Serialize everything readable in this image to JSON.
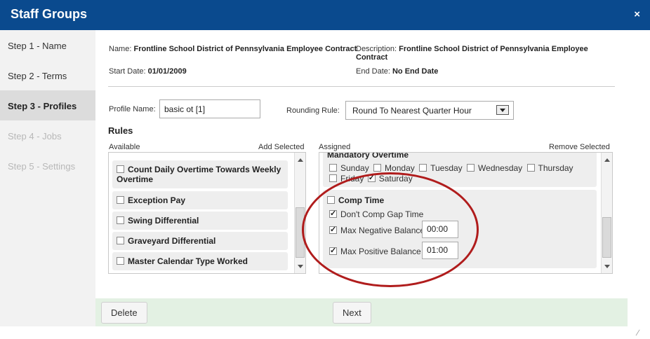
{
  "window": {
    "title": "Staff Groups",
    "close_glyph": "×"
  },
  "steps": [
    {
      "label": "Step 1 - Name"
    },
    {
      "label": "Step 2 - Terms"
    },
    {
      "label": "Step 3 - Profiles"
    },
    {
      "label": "Step 4 - Jobs"
    },
    {
      "label": "Step 5 - Settings"
    }
  ],
  "info": {
    "name_label": "Name:",
    "name_value": "Frontline School District of Pennsylvania Employee Contract",
    "description_label": "Description:",
    "description_value_line1": "Frontline School District of Pennsylvania Employee",
    "description_value_line2": "Contract",
    "start_label": "Start Date:",
    "start_value": "01/01/2009",
    "end_label": "End Date:",
    "end_value": "No End Date"
  },
  "profile": {
    "name_label": "Profile Name:",
    "name_value": "basic ot [1]",
    "rounding_label": "Rounding Rule:",
    "rounding_value": "Round To Nearest Quarter Hour"
  },
  "rules": {
    "heading": "Rules",
    "available_label": "Available",
    "add_selected": "Add Selected",
    "assigned_label": "Assigned",
    "remove_selected": "Remove Selected",
    "available_items": [
      {
        "label_line1": "Count Daily Overtime Towards Weekly",
        "label_line2": "Overtime"
      },
      {
        "label": "Exception Pay"
      },
      {
        "label": "Swing Differential"
      },
      {
        "label": "Graveyard Differential"
      },
      {
        "label": "Master Calendar Type Worked"
      }
    ],
    "assigned": {
      "cut_item": "Mandatory Overtime",
      "days": [
        "Sunday",
        "Monday",
        "Tuesday",
        "Wednesday",
        "Thursday",
        "Friday",
        "Saturday"
      ],
      "comp_time_label": "Comp Time",
      "dont_comp_gap": "Don't Comp Gap Time",
      "max_negative_label": "Max Negative Balance",
      "max_negative_value": "00:00",
      "max_positive_label": "Max Positive Balance",
      "max_positive_value": "01:00"
    }
  },
  "footer": {
    "delete_label": "Delete",
    "next_label": "Next"
  },
  "colors": {
    "titlebar": "#0a4a8e",
    "footer": "#e3f1e3",
    "annotation": "#b01c1c"
  }
}
